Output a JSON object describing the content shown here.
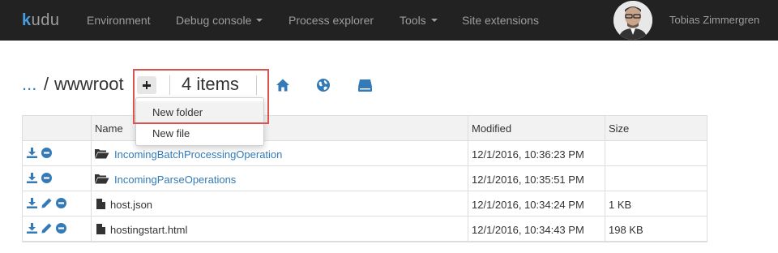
{
  "navbar": {
    "brand": "udu",
    "brand_k": "k",
    "items": [
      {
        "label": "Environment"
      },
      {
        "label": "Debug console"
      },
      {
        "label": "Process explorer"
      },
      {
        "label": "Tools"
      },
      {
        "label": "Site extensions"
      }
    ],
    "user_name": "Tobias Zimmergren"
  },
  "breadcrumb": {
    "ellipsis": "...",
    "separator": "/",
    "current": "wwwroot"
  },
  "toolbar": {
    "items_count": "4 items",
    "icons": [
      "home-icon",
      "globe-icon",
      "drive-icon"
    ]
  },
  "dropdown": {
    "items": [
      {
        "label": "New folder"
      },
      {
        "label": "New file"
      }
    ]
  },
  "table": {
    "columns": [
      "Name",
      "Modified",
      "Size"
    ],
    "rows": [
      {
        "name": "IncomingBatchProcessingOperation",
        "type": "folder",
        "modified": "12/1/2016, 10:36:23 PM",
        "size": ""
      },
      {
        "name": "IncomingParseOperations",
        "type": "folder",
        "modified": "12/1/2016, 10:35:51 PM",
        "size": ""
      },
      {
        "name": "host.json",
        "type": "file",
        "modified": "12/1/2016, 10:34:24 PM",
        "size": "1 KB"
      },
      {
        "name": "hostingstart.html",
        "type": "file",
        "modified": "12/1/2016, 10:34:43 PM",
        "size": "198 KB"
      }
    ]
  },
  "colors": {
    "navbar_bg": "#222222",
    "link": "#337ab7",
    "highlight": "#d9534f"
  }
}
